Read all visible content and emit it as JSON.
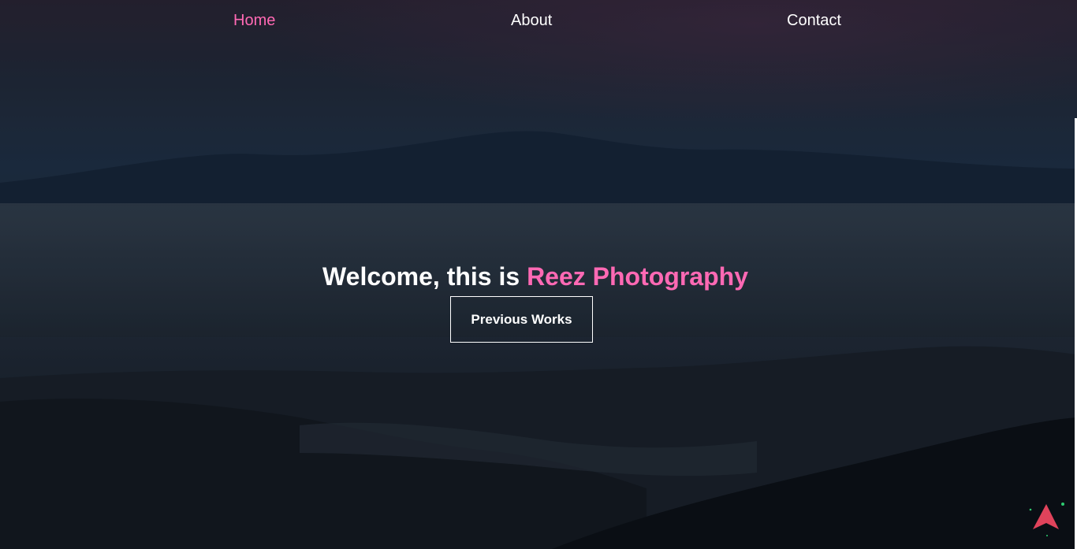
{
  "nav": {
    "items": [
      {
        "label": "Home",
        "active": true
      },
      {
        "label": "About",
        "active": false
      },
      {
        "label": "Contact",
        "active": false
      }
    ]
  },
  "hero": {
    "headline_prefix": "Welcome, this is",
    "headline_brand": "Reez Photography",
    "cta_label": "Previous Works",
    "background": "misty mountain landscape at dusk"
  },
  "colors": {
    "accent": "#ff69b4",
    "text": "#ffffff",
    "badge": "#e0435b",
    "badge_dots": "#2ecc71"
  },
  "icons": {
    "scroll_badge": "navigation-arrow-icon"
  }
}
